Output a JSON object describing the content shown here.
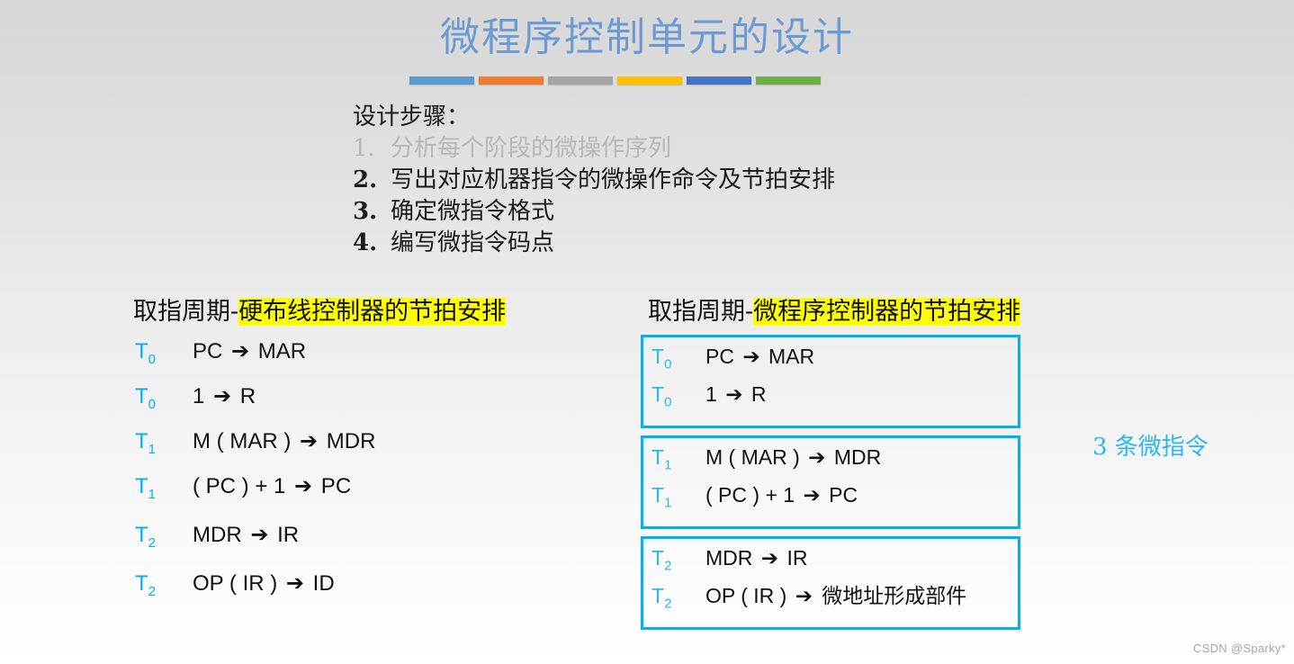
{
  "slide": {
    "title": "微程序控制单元的设计",
    "title_color": "#6b9bd2",
    "background_gradient": [
      "#d7d7d7",
      "#ffffff"
    ],
    "watermark": "CSDN @Sparky*"
  },
  "decor_bars": [
    {
      "name": "bar-blue",
      "color": "#5b9bd5"
    },
    {
      "name": "bar-orange",
      "color": "#ed7d31"
    },
    {
      "name": "bar-gray",
      "color": "#a5a5a5"
    },
    {
      "name": "bar-yellow",
      "color": "#ffc000"
    },
    {
      "name": "bar-dark-blue",
      "color": "#4472c4"
    },
    {
      "name": "bar-green",
      "color": "#70ad47"
    }
  ],
  "steps": {
    "heading": "设计步骤：",
    "items": [
      {
        "num": "1.",
        "text": "分析每个阶段的微操作序列",
        "dim": true
      },
      {
        "num": "2.",
        "text": "写出对应机器指令的微操作命令及节拍安排",
        "dim": false
      },
      {
        "num": "3.",
        "text": "确定微指令格式",
        "dim": false
      },
      {
        "num": "4.",
        "text": "编写微指令码点",
        "dim": false
      }
    ]
  },
  "left_column": {
    "heading_plain": "取指周期-",
    "heading_highlight": "硬布线控制器的节拍安排",
    "highlight_color": "#ffff00",
    "t_label_color": "#00b0f0",
    "rows": [
      {
        "t": "T",
        "sub": "0",
        "expr_pre": "PC",
        "arrow": "➔",
        "expr_post": "MAR"
      },
      {
        "t": "T",
        "sub": "0",
        "expr_pre": "1",
        "arrow": "➔",
        "expr_post": "R"
      },
      {
        "t": "T",
        "sub": "1",
        "expr_pre": "M ( MAR )",
        "arrow": "➔",
        "expr_post": "MDR"
      },
      {
        "t": "T",
        "sub": "1",
        "expr_pre": "( PC ) + 1",
        "arrow": "➔",
        "expr_post": "PC"
      },
      {
        "t": "T",
        "sub": "2",
        "expr_pre": "MDR",
        "arrow": "➔",
        "expr_post": "IR"
      },
      {
        "t": "T",
        "sub": "2",
        "expr_pre": "OP ( IR )",
        "arrow": "➔",
        "expr_post": "ID"
      }
    ]
  },
  "right_column": {
    "heading_plain": "取指周期-",
    "heading_highlight": "微程序控制器的节拍安排",
    "highlight_color": "#ffff00",
    "box_border_color": "#00b0f0",
    "t_label_color": "#2eb6ef",
    "boxes": [
      {
        "name": "microinstruction-box-1",
        "rows": [
          {
            "t": "T",
            "sub": "0",
            "expr_pre": "PC",
            "arrow": "➔",
            "expr_post": "MAR"
          },
          {
            "t": "T",
            "sub": "0",
            "expr_pre": "1",
            "arrow": "➔",
            "expr_post": "R"
          }
        ]
      },
      {
        "name": "microinstruction-box-2",
        "rows": [
          {
            "t": "T",
            "sub": "1",
            "expr_pre": "M ( MAR )",
            "arrow": "➔",
            "expr_post": "MDR"
          },
          {
            "t": "T",
            "sub": "1",
            "expr_pre": "( PC ) + 1",
            "arrow": "➔",
            "expr_post": "PC"
          }
        ]
      },
      {
        "name": "microinstruction-box-3",
        "rows": [
          {
            "t": "T",
            "sub": "2",
            "expr_pre": "MDR",
            "arrow": "➔",
            "expr_post": "IR"
          },
          {
            "t": "T",
            "sub": "2",
            "expr_pre": "OP ( IR )",
            "arrow": "➔",
            "expr_post": "微地址形成部件",
            "post_is_cn": true
          }
        ]
      }
    ]
  },
  "side_note": {
    "text": "3 条微指令",
    "color": "#2eb6ef"
  }
}
